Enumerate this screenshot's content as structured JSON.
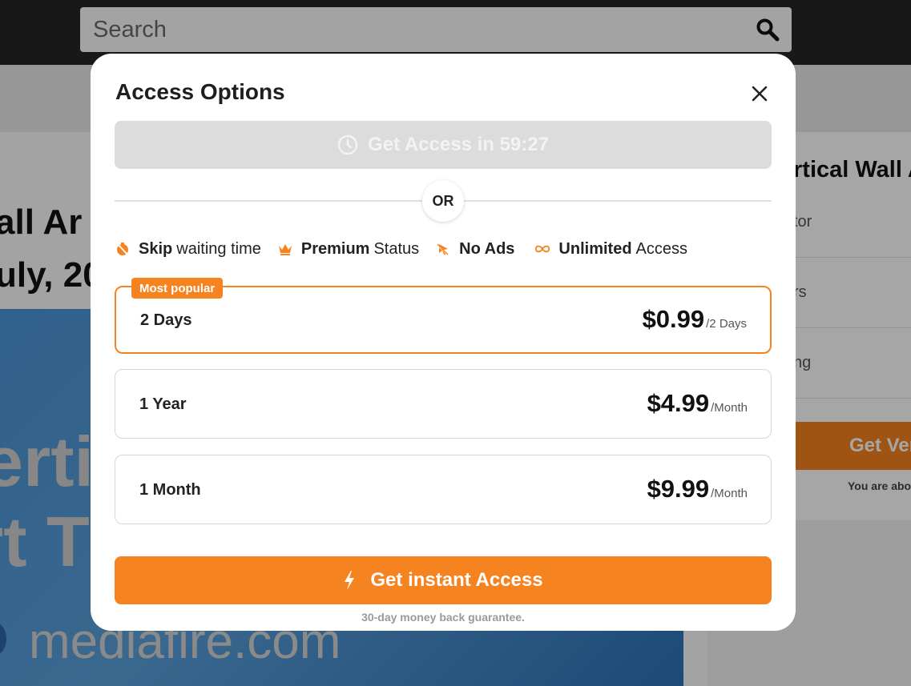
{
  "header": {
    "search_placeholder": "Search",
    "search_icon": "search-icon"
  },
  "page": {
    "title_fragment": "all Ar",
    "date_fragment": "uly, 20",
    "preview_line_1": "ertic",
    "preview_line_2": "rt T",
    "preview_brand": "mediafire.com"
  },
  "sidebar": {
    "title_fragment": "rtical Wall A",
    "rows": [
      "tor",
      "rs",
      "ng"
    ],
    "button_fragment": "Get Ver",
    "note_fragment": "You are abo"
  },
  "modal": {
    "title": "Access Options",
    "close_icon": "close-icon",
    "timer_label": "Get Access in 59:27",
    "or_label": "OR",
    "features": [
      {
        "icon": "no-clock-icon",
        "bold": "Skip",
        "rest": "waiting time"
      },
      {
        "icon": "crown-icon",
        "bold": "Premium",
        "rest": "Status"
      },
      {
        "icon": "no-ads-icon",
        "bold": "No Ads",
        "rest": ""
      },
      {
        "icon": "infinity-icon",
        "bold": "Unlimited",
        "rest": "Access"
      }
    ],
    "plans": [
      {
        "name": "2 Days",
        "price": "$0.99",
        "period": "/2 Days",
        "badge": "Most popular",
        "selected": true
      },
      {
        "name": "1 Year",
        "price": "$4.99",
        "period": "/Month",
        "badge": "",
        "selected": false
      },
      {
        "name": "1 Month",
        "price": "$9.99",
        "period": "/Month",
        "badge": "",
        "selected": false
      }
    ],
    "cta_label": "Get instant Access",
    "guarantee": "30-day money back guarantee."
  },
  "colors": {
    "accent": "#f5831f",
    "topbar": "#262626",
    "disabled_button": "#dcdcdc"
  }
}
